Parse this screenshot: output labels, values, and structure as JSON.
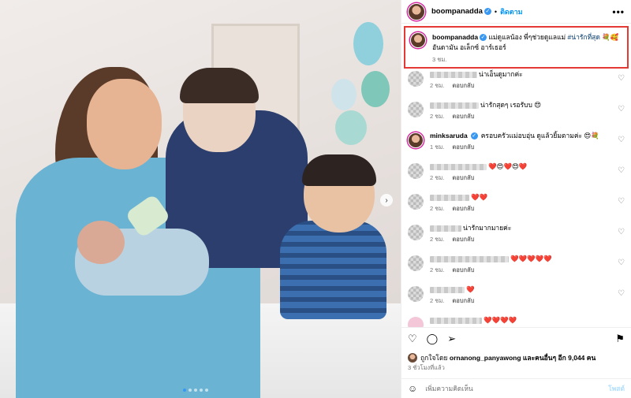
{
  "post": {
    "username": "boompanadda",
    "follow_label": "ติดตาม",
    "more_icon": "•••"
  },
  "caption": {
    "username": "boompanadda",
    "text": "แม่ดูแลน้อง พี่ๆช่วยดูแลแม่",
    "hashtag": "#น่ารักที่สุด",
    "emoji": "💐🥰",
    "line2": "อันดามัน อเล็กซ์ อาร์เธอร์",
    "time": "3 ชม."
  },
  "comments": [
    {
      "text": "น่าเอ็นดูมากค่ะ",
      "time": "2 ชม.",
      "reply": "ตอบกลับ",
      "name": ""
    },
    {
      "text": "น่ารักสุดๆ เรอรับบ 😍",
      "time": "2 ชม.",
      "reply": "ตอบกลับ",
      "name": ""
    },
    {
      "text": "ครอบครัวแม่อบอุ่น ดูแล้วยิ้มตามค่ะ 😍💐",
      "time": "1 ชม.",
      "reply": "ตอบกลับ",
      "name": "minksaruda"
    },
    {
      "text": "❤️😍❤️😍❤️",
      "time": "2 ชม.",
      "reply": "ตอบกลับ",
      "name": ""
    },
    {
      "text": "❤️❤️",
      "time": "2 ชม.",
      "reply": "ตอบกลับ",
      "name": ""
    },
    {
      "text": "น่ารักมากมายค่ะ",
      "time": "2 ชม.",
      "reply": "ตอบกลับ",
      "name": ""
    },
    {
      "text": "❤️❤️❤️❤️❤️",
      "time": "2 ชม.",
      "reply": "ตอบกลับ",
      "name": ""
    },
    {
      "text": "❤️",
      "time": "2 ชม.",
      "reply": "ตอบกลับ",
      "name": ""
    },
    {
      "text": "❤️❤️❤️❤️",
      "time": "",
      "reply": "",
      "name": ""
    }
  ],
  "likes": {
    "prefix": "ถูกใจโดย",
    "user": "ornanong_panyawong",
    "suffix": "และคนอื่นๆ อีก 9,044 คน"
  },
  "posted_ago": "3 ชั่วโมงที่แล้ว",
  "add_comment": {
    "placeholder": "เพิ่มความคิดเห็น",
    "post_label": "โพสต์"
  },
  "colors": {
    "highlight_border": "#e53935",
    "link_blue": "#0095f6",
    "hashtag": "#00376b"
  }
}
